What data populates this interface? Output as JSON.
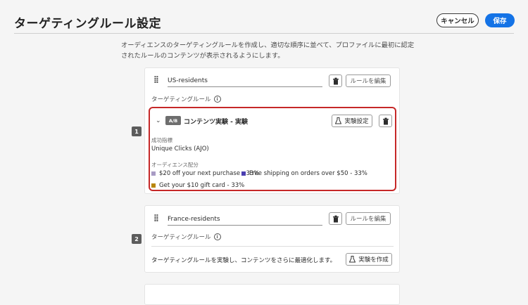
{
  "header": {
    "title": "ターゲティングルール設定",
    "cancel_label": "キャンセル",
    "save_label": "保存"
  },
  "description": "オーディエンスのターゲティングルールを作成し、適切な順序に並べて、プロファイルに最初に認定されたルールのコンテンツが表示されるようにします。",
  "rules": [
    {
      "number": "1",
      "name": "US-residents",
      "edit_label": "ルールを編集",
      "section_label": "ターゲティングルール",
      "experiment": {
        "badge": "A/B",
        "title": "コンテンツ実験 - 実験",
        "settings_label": "実験設定",
        "success_metric_label": "成功指標",
        "success_metric_value": "Unique Clicks (AJO)",
        "distribution_label": "オーディエンス配分",
        "treatments": [
          {
            "label": "$20 off your next purchase - 33%",
            "color": "#a89bc4"
          },
          {
            "label": "Free shipping on orders over $50 - 33%",
            "color": "#4a3fb0"
          },
          {
            "label": "Get your $10 gift card - 33%",
            "color": "#b8860b"
          }
        ]
      }
    },
    {
      "number": "2",
      "name": "France-residents",
      "edit_label": "ルールを編集",
      "section_label": "ターゲティングルール",
      "cta_text": "ターゲティングルールを実験し、コンテンツをさらに最適化します。",
      "create_label": "実験を作成"
    }
  ]
}
